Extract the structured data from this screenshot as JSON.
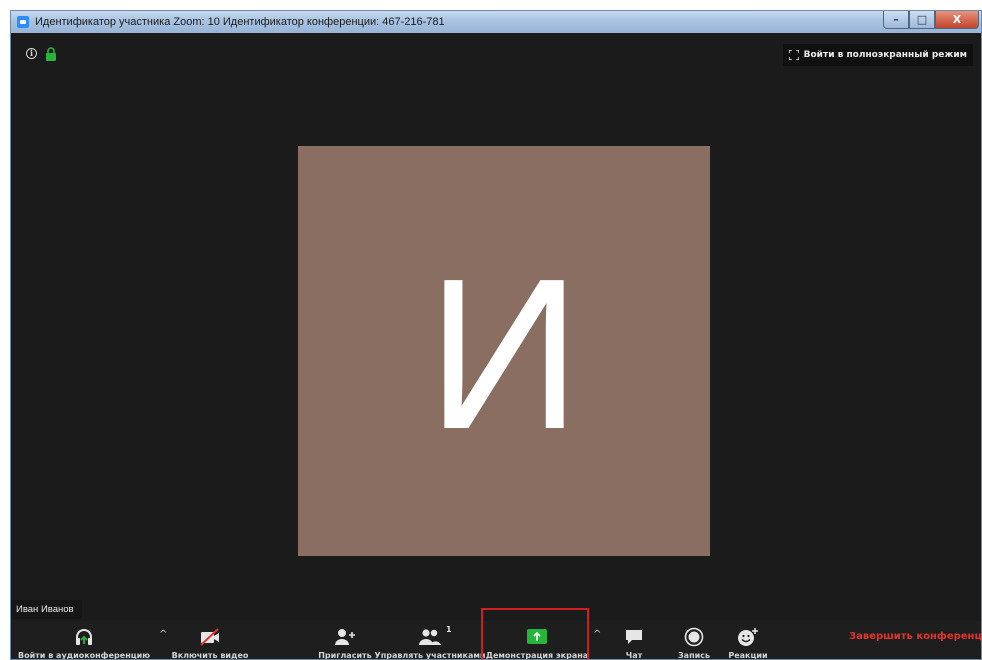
{
  "window": {
    "title": "Идентификатор участника Zoom: 10   Идентификатор конференции: 467-216-781",
    "min_glyph": "–",
    "max_glyph": "□",
    "close_glyph": "X"
  },
  "topbar": {
    "fullscreen_label": "Войти в полноэкранный режим"
  },
  "participant": {
    "initial": "И",
    "name": "Иван Иванов",
    "avatar_color": "#8a6e61"
  },
  "toolbar": {
    "audio_label": "Войти в аудиоконференцию",
    "video_label": "Включить видео",
    "invite_label": "Пригласить",
    "participants_label": "Управлять участниками",
    "participants_count": "1",
    "share_label": "Демонстрация экрана",
    "chat_label": "Чат",
    "record_label": "Запись",
    "reactions_label": "Реакции",
    "end_label": "Завершить конференцию",
    "caret_glyph": "^"
  },
  "colors": {
    "accent_green": "#26b53a",
    "end_red": "#e0342e",
    "highlight_red": "#d11d1d"
  }
}
